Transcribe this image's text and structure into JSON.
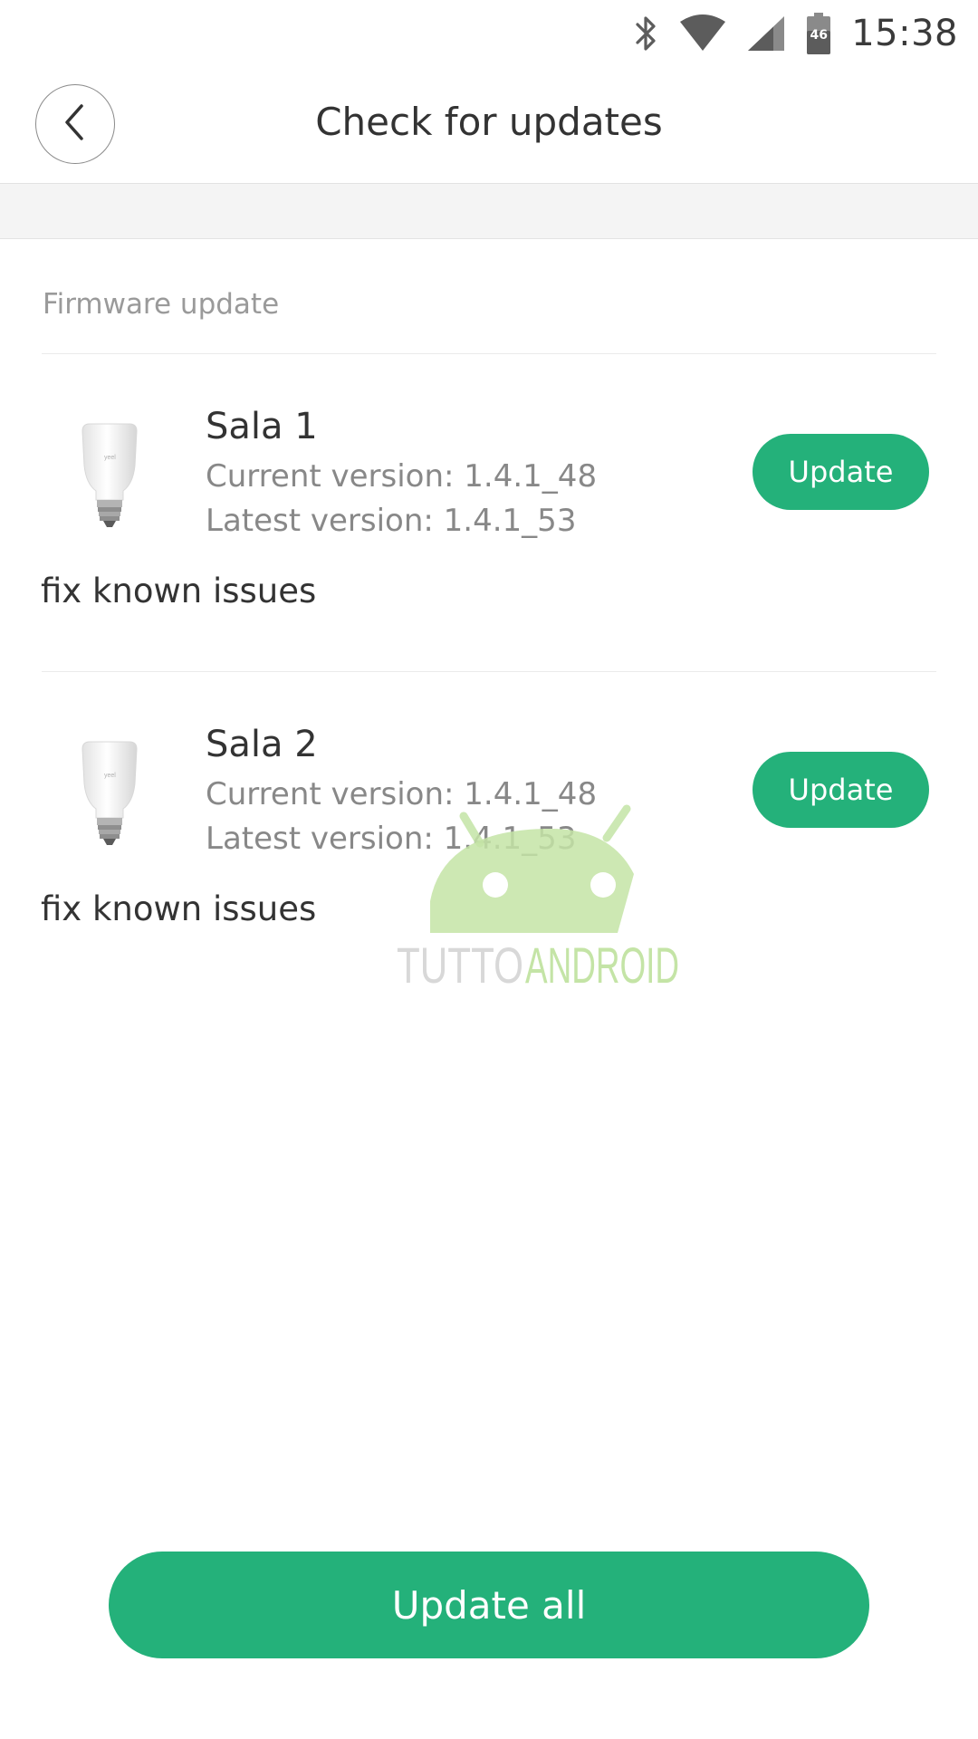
{
  "status_bar": {
    "time": "15:38",
    "battery_level": "46",
    "icons": [
      "bluetooth-icon",
      "wifi-icon",
      "cellular-signal-icon",
      "battery-icon"
    ]
  },
  "header": {
    "title": "Check for updates",
    "back_icon": "chevron-left-icon"
  },
  "section": {
    "title": "Firmware update"
  },
  "devices": [
    {
      "name": "Sala 1",
      "current_version": "Current version: 1.4.1_48",
      "latest_version": "Latest version: 1.4.1_53",
      "update_label": "Update",
      "notes": "fix known issues",
      "icon": "light-bulb-icon"
    },
    {
      "name": "Sala 2",
      "current_version": "Current version: 1.4.1_48",
      "latest_version": "Latest version: 1.4.1_53",
      "update_label": "Update",
      "notes": "fix known issues",
      "icon": "light-bulb-icon"
    }
  ],
  "watermark": {
    "text_dark": "TUTTO",
    "text_green": "ANDROID"
  },
  "footer": {
    "update_all_label": "Update all"
  },
  "colors": {
    "accent": "#24b17a",
    "watermark_green": "#a5d57a"
  }
}
